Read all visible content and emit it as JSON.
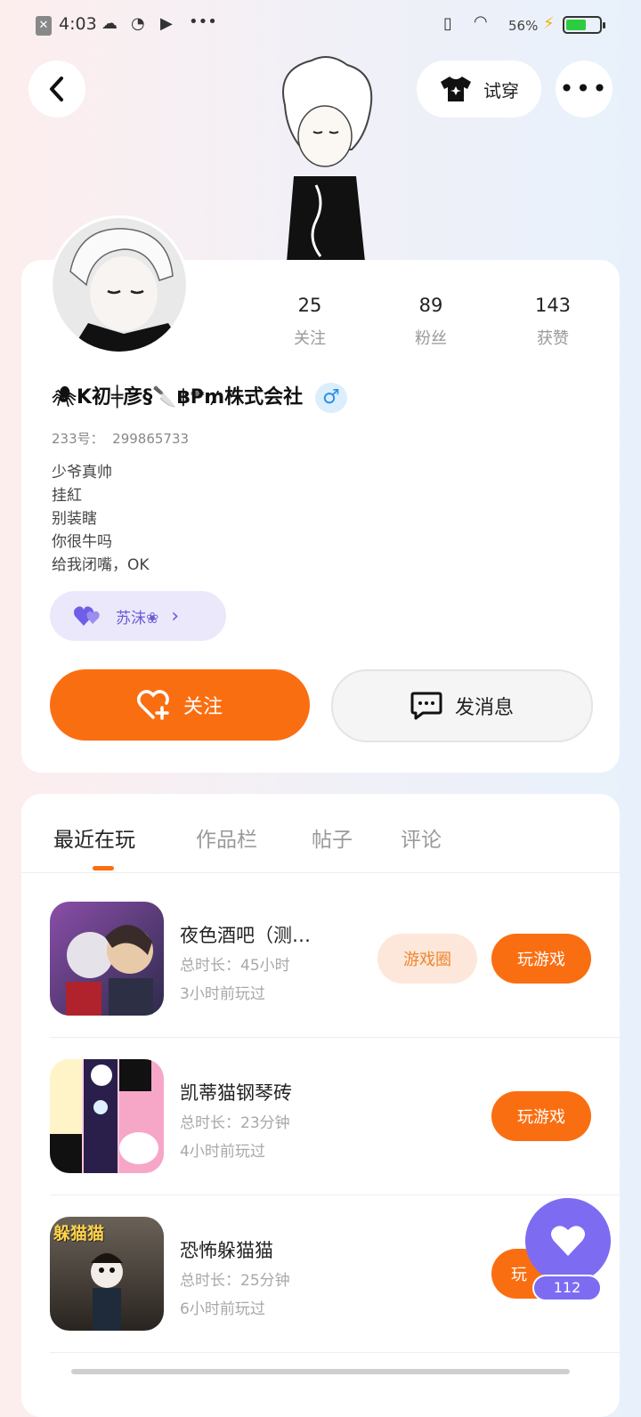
{
  "status_bar": {
    "time": "4:03",
    "battery": "56%"
  },
  "header": {
    "try_on_label": "试穿"
  },
  "profile": {
    "stats": [
      {
        "value": "25",
        "label": "关注"
      },
      {
        "value": "89",
        "label": "粉丝"
      },
      {
        "value": "143",
        "label": "获赞"
      }
    ],
    "username": "🕷K初╪彦§🔪฿₱₥株式会社",
    "gender_symbol": "♂",
    "id_line": "233号：  299865733",
    "bio_lines": [
      "少爷真帅",
      "挂紅",
      "别装瞎",
      "你很牛吗",
      "给我闭嘴，OK"
    ],
    "companion_tag": "苏沫❀",
    "follow_label": "关注",
    "message_label": "发消息"
  },
  "tabs": [
    "最近在玩",
    "作品栏",
    "帖子",
    "评论"
  ],
  "games": [
    {
      "title": "夜色酒吧（测…",
      "duration": "总时长：45小时",
      "last_played": "3小时前玩过",
      "circle_label": "游戏圈",
      "play_label": "玩游戏"
    },
    {
      "title": "凯蒂猫钢琴砖",
      "duration": "总时长：23分钟",
      "last_played": "4小时前玩过",
      "play_label": "玩游戏"
    },
    {
      "title": "恐怖躲猫猫",
      "duration": "总时长：25分钟",
      "last_played": "6小时前玩过",
      "play_label": "玩",
      "icon_text": "躲猫猫"
    }
  ],
  "like_float": {
    "count": "112"
  },
  "colors": {
    "accent": "#fa6e12",
    "purple": "#7d6cf2"
  }
}
